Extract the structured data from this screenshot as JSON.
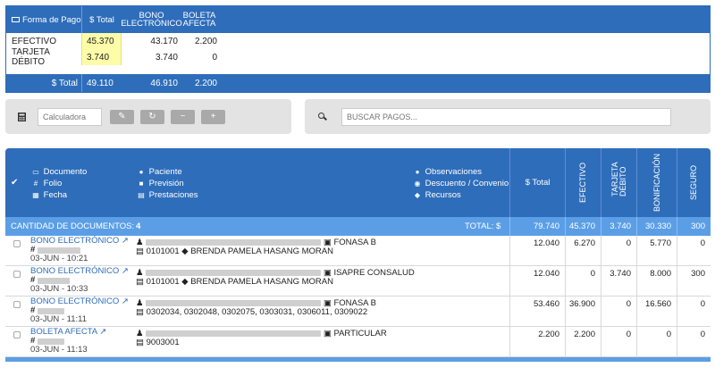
{
  "summary": {
    "headers": {
      "forma": "Forma de Pago",
      "total": "$ Total",
      "bono": "BONO ELECTRÓNICO",
      "boleta": "BOLETA AFECTA"
    },
    "rows": [
      {
        "forma": "EFECTIVO",
        "total": "45.370",
        "bono": "43.170",
        "boleta": "2.200"
      },
      {
        "forma": "TARJETA DÉBITO",
        "total": "3.740",
        "bono": "3.740",
        "boleta": "0"
      }
    ],
    "footer": {
      "label": "$ Total",
      "total": "49.110",
      "bono": "46.910",
      "boleta": "2.200"
    }
  },
  "toolbar": {
    "calc_placeholder": "Calculadora",
    "search_placeholder": "BUSCAR PAGOS..."
  },
  "table": {
    "headers": {
      "documento": "Documento",
      "folio": "Folio",
      "fecha": "Fecha",
      "paciente": "Paciente",
      "prevision": "Previsión",
      "prestaciones": "Prestaciones",
      "observaciones": "Observaciones",
      "descuento": "Descuento / Convenio",
      "recursos": "Recursos",
      "total": "$ Total",
      "efectivo": "EFECTIVO",
      "tarjeta": "TARJETA DÉBITO",
      "bonificacion": "BONIFICACIÓN",
      "seguro": "SEGURO"
    },
    "count_label": "CANTIDAD DE DOCUMENTOS:",
    "count_value": "4",
    "total_label": "TOTAL: $",
    "totals": {
      "total": "79.740",
      "efectivo": "45.370",
      "tarjeta": "3.740",
      "bonificacion": "30.330",
      "seguro": "300"
    },
    "rows": [
      {
        "doc": "BONO ELECTRÓNICO",
        "date": "03-JUN - 10:21",
        "prevision": "FONASA B",
        "codes": "0101001",
        "prestador": "BRENDA PAMELA HASANG MORAN",
        "total": "12.040",
        "efectivo": "6.270",
        "tarjeta": "0",
        "bonificacion": "5.770",
        "seguro": "0"
      },
      {
        "doc": "BONO ELECTRÓNICO",
        "date": "03-JUN - 10:33",
        "prevision": "ISAPRE CONSALUD",
        "codes": "0101001",
        "prestador": "BRENDA PAMELA HASANG MORAN",
        "total": "12.040",
        "efectivo": "0",
        "tarjeta": "3.740",
        "bonificacion": "8.000",
        "seguro": "300"
      },
      {
        "doc": "BONO ELECTRÓNICO",
        "date": "03-JUN - 11:11",
        "prevision": "FONASA B",
        "codes": "0302034, 0302048, 0302075, 0303031, 0306011, 0309022",
        "prestador": "",
        "total": "53.460",
        "efectivo": "36.900",
        "tarjeta": "0",
        "bonificacion": "16.560",
        "seguro": "0"
      },
      {
        "doc": "BOLETA AFECTA",
        "date": "03-JUN - 11:13",
        "prevision": "PARTICULAR",
        "codes": "9003001",
        "prestador": "",
        "total": "2.200",
        "efectivo": "2.200",
        "tarjeta": "0",
        "bonificacion": "0",
        "seguro": "0"
      }
    ]
  }
}
